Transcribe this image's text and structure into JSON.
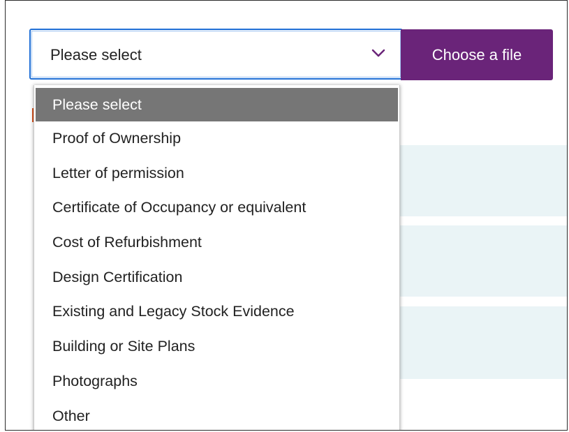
{
  "select": {
    "value": "Please select",
    "icon": "chevron-down-icon",
    "focus_color": "#1f6fd6"
  },
  "upload_button": {
    "label": "Choose a file",
    "color": "#6a2479"
  },
  "dropdown": {
    "options": [
      "Please select",
      "Proof of Ownership",
      "Letter of permission",
      "Certificate of Occupancy or equivalent",
      "Cost of Refurbishment",
      "Design Certification",
      "Existing and Legacy Stock Evidence",
      "Building or Site Plans",
      "Photographs",
      "Other"
    ],
    "selected_index": 0,
    "highlight_color": "#767676"
  }
}
